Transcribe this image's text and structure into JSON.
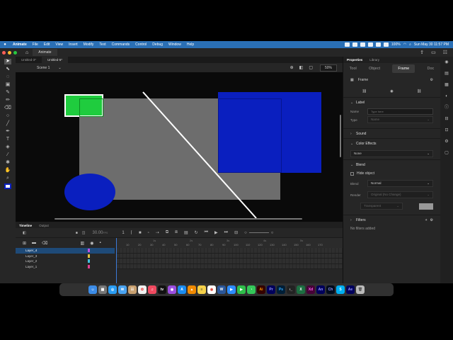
{
  "menubar": {
    "app_name": "Animate",
    "items": [
      "File",
      "Edit",
      "View",
      "Insert",
      "Modify",
      "Text",
      "Commands",
      "Control",
      "Debug",
      "Window",
      "Help"
    ],
    "battery": "100%",
    "datetime": "Sun May 30  11:57 PM"
  },
  "titlebar": {
    "app_tab": "Animate"
  },
  "doc_tabs": [
    "Untitled-3*",
    "Untitled-5*"
  ],
  "scene": {
    "label": "Scene 1",
    "zoom": "50%"
  },
  "timeline": {
    "tabs": [
      "Timeline",
      "Output"
    ],
    "fps": "30.00",
    "fps_unit": "FPS",
    "frame": "1",
    "seconds": [
      "1s",
      "2s",
      "3s",
      "4s",
      "5s"
    ],
    "frame_numbers": [
      "10",
      "20",
      "30",
      "40",
      "50",
      "60",
      "70",
      "80",
      "90",
      "100",
      "110",
      "120",
      "130",
      "140",
      "150",
      "160",
      "170"
    ],
    "layers": [
      {
        "name": "Layer_4",
        "color": "#c050e0"
      },
      {
        "name": "Layer_3",
        "color": "#e0c040"
      },
      {
        "name": "Layer_2",
        "color": "#40c0e0"
      },
      {
        "name": "Layer_1",
        "color": "#e04090"
      }
    ]
  },
  "properties": {
    "tabs": [
      "Properties",
      "Library"
    ],
    "subtabs": [
      "Tool",
      "Object",
      "Frame",
      "Doc"
    ],
    "frame_label": "Frame",
    "label_section": "Label",
    "name_label": "Name",
    "name_placeholder": "Type here",
    "type_label": "Type",
    "type_value": "Name",
    "sound_section": "Sound",
    "color_effects_section": "Color Effects",
    "color_effect_value": "None",
    "blend_section": "Blend",
    "hide_object": "Hide object",
    "blend_label": "Blend",
    "blend_value": "Normal",
    "render_label": "Render",
    "render_value": "Original (No Change)",
    "transparent_value": "Transparent",
    "filters_section": "Filters",
    "no_filters": "No filters added"
  },
  "colors": {
    "menubar": "#2a6fb5",
    "stage_gray": "#6d6d6d",
    "blue_shape": "#0a1fbf",
    "green_shape": "#1fcc3e",
    "selection": "#1e4a78"
  },
  "dock_apps": [
    "finder",
    "launchpad",
    "safari",
    "mail",
    "contacts",
    "photos",
    "music",
    "tv",
    "podcasts",
    "app-store",
    "vlc",
    "notes",
    "chrome",
    "word",
    "zoom",
    "facetime",
    "messages",
    "illustrator",
    "premiere",
    "photoshop",
    "terminal",
    "excel",
    "xd",
    "animate",
    "character-animator",
    "skype",
    "after-effects",
    "trash"
  ]
}
